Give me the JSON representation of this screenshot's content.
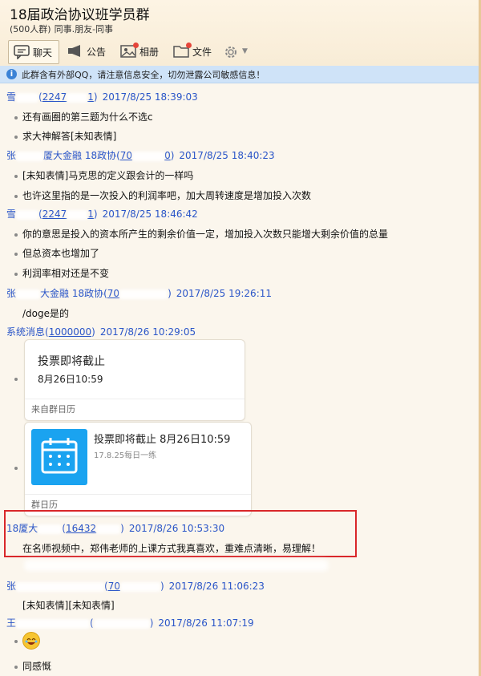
{
  "header": {
    "title": "18届政治协议班学员群",
    "member_count": "(500人群)",
    "tags": "同事.朋友-同事"
  },
  "toolbar": {
    "tabs": [
      {
        "label": "聊天",
        "icon": "chat-bubble-icon"
      },
      {
        "label": "公告",
        "icon": "megaphone-icon"
      },
      {
        "label": "相册",
        "icon": "photo-album-icon"
      },
      {
        "label": "文件",
        "icon": "folder-icon"
      }
    ],
    "settings_icon": "gear-icon"
  },
  "notice": {
    "text": "此群含有外部QQ，请注意信息安全，切勿泄露公司敏感信息！"
  },
  "messages": [
    {
      "sender": "雪",
      "id": "2247",
      "id_tail": "1",
      "time": "2017/8/25 18:39:03",
      "lines": [
        "还有画圈的第三题为什么不选c",
        "求大神解答[未知表情]"
      ]
    },
    {
      "sender": "张",
      "sender2": "厦大金融 18政协",
      "id": "70",
      "id_tail": "0",
      "time": "2017/8/25 18:40:23",
      "lines": [
        "[未知表情]马克思的定义跟会计的一样吗",
        "也许这里指的是一次投入的利润率吧，加大周转速度是增加投入次数"
      ]
    },
    {
      "sender": "雪",
      "id": "2247",
      "id_tail": "1",
      "time": "2017/8/25 18:46:42",
      "lines": [
        "你的意思是投入的资本所产生的剩余价值一定，增加投入次数只能增大剩余价值的总量",
        "但总资本也增加了",
        "利润率相对还是不变"
      ]
    },
    {
      "sender": "张",
      "sender2": "大金融 18政协",
      "id": "70",
      "id_tail": "",
      "time": "2017/8/25 19:26:11",
      "lines": [
        "/doge是的"
      ]
    },
    {
      "sender": "系统消息",
      "id": "1000000",
      "time": "2017/8/26 10:29:05"
    },
    {
      "sender": "18厦大",
      "id": "16432",
      "time": "2017/8/26 10:53:30",
      "lines": [
        "在名师视频中，郑伟老师的上课方式我真喜欢，重难点清晰，易理解！"
      ]
    },
    {
      "sender": "张",
      "id": "70",
      "time": "2017/8/26 11:06:23",
      "lines": [
        "[未知表情][未知表情]"
      ]
    },
    {
      "sender": "王",
      "id": "",
      "time": "2017/8/26 11:07:19",
      "lines": [
        "同感慨"
      ]
    }
  ],
  "cards": [
    {
      "title": "投票即将截止",
      "subtitle": "8月26日10:59",
      "footer": "来自群日历"
    },
    {
      "title": "投票即将截止 8月26日10:59",
      "subtitle": "17.8.25每日一练",
      "footer": "群日历"
    }
  ],
  "colors": {
    "sender": "#2a55c8",
    "notice_bg": "#cfe3f8",
    "highlight": "#d9272a",
    "calendar": "#1aa3f0"
  }
}
